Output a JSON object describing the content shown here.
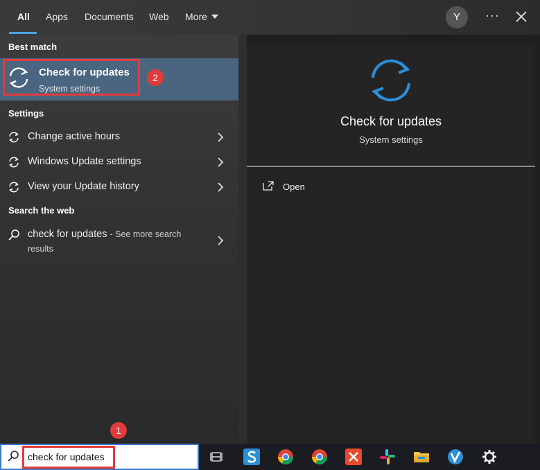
{
  "tabs": [
    {
      "label": "All",
      "active": true
    },
    {
      "label": "Apps"
    },
    {
      "label": "Documents"
    },
    {
      "label": "Web"
    },
    {
      "label": "More"
    }
  ],
  "header": {
    "avatar_initial": "Y",
    "more_options": "···"
  },
  "sections": {
    "best_match": "Best match",
    "settings": "Settings",
    "search_web": "Search the web"
  },
  "best_match_item": {
    "title": "Check for updates",
    "subtitle": "System settings",
    "icon": "sync-icon"
  },
  "settings_items": [
    {
      "label": "Change active hours"
    },
    {
      "label": "Windows Update settings"
    },
    {
      "label": "View your Update history"
    }
  ],
  "web_item": {
    "query": "check for updates",
    "suffix": "- See more search",
    "suffix2": "results"
  },
  "preview": {
    "title": "Check for updates",
    "subtitle": "System settings",
    "action": "Open"
  },
  "search": {
    "value": "check for updates"
  },
  "badges": {
    "one": "1",
    "two": "2"
  },
  "colors": {
    "accent": "#2b8fd9",
    "highlight": "#e23b3b",
    "selection": "#4a6580"
  }
}
